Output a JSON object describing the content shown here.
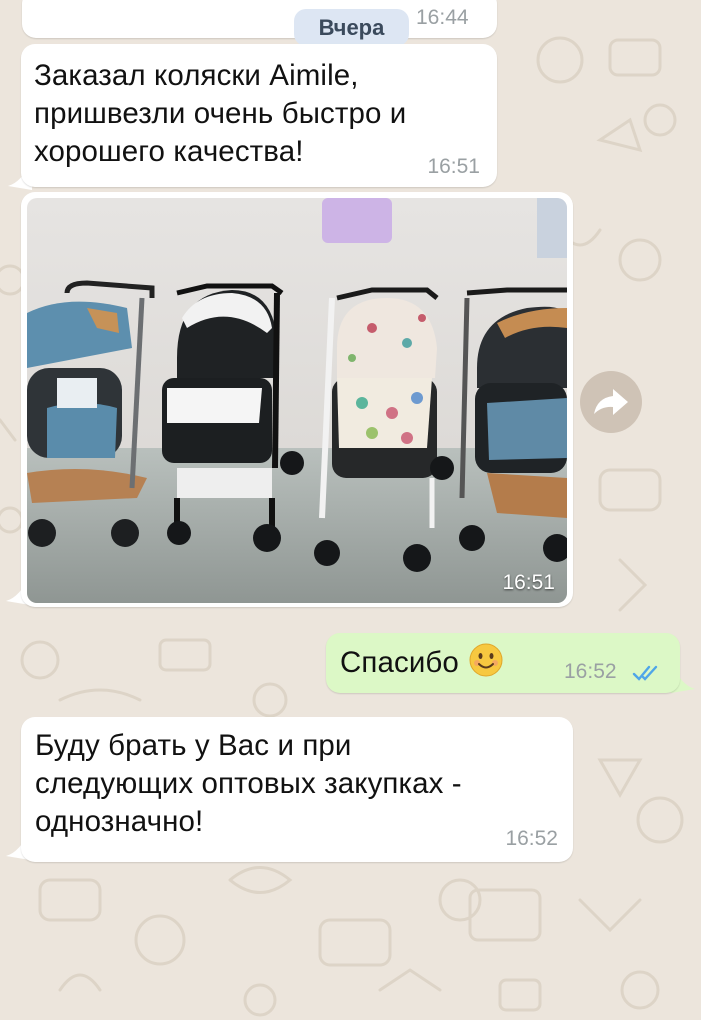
{
  "chat": {
    "date_badge": "Вчера",
    "badge_time": "16:44",
    "messages": [
      {
        "direction": "in",
        "text": "Заказал коляски Aimile,\nпришвезли очень быстро и\nхорошего качества!",
        "time": "16:51"
      },
      {
        "direction": "in",
        "type": "photo",
        "time": "16:51"
      },
      {
        "direction": "out",
        "text": "Спасибо",
        "emoji": "smiling-face",
        "time": "16:52",
        "status": "read"
      },
      {
        "direction": "in",
        "text": "Буду брать у Вас и при\nследующих оптовых закупках -\nоднозначно!",
        "time": "16:52"
      }
    ]
  },
  "icons": {
    "forward": "forward-arrow-icon",
    "read_receipt": "double-check-icon",
    "emoji": "smiling-face-emoji"
  },
  "colors": {
    "background": "#ece5dc",
    "incoming_bubble": "#ffffff",
    "outgoing_bubble": "#dcf8c6",
    "read_tick": "#4fa6e8",
    "date_badge": "#dde6f3"
  }
}
